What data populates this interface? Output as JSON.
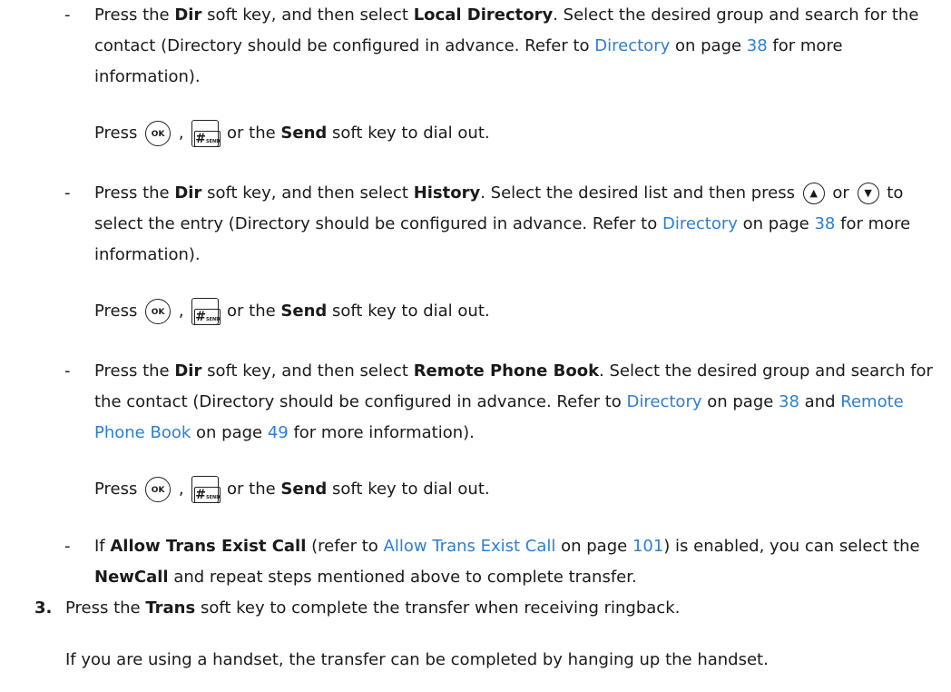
{
  "colors": {
    "link": "#2d7fd0",
    "text": "#1a1a1a"
  },
  "keys": {
    "ok": "OK",
    "send_hash": "#",
    "send_sub": "SEND",
    "up": "▲",
    "down": "▼"
  },
  "bullet_dash": "-",
  "item1": {
    "t1": "Press the ",
    "b1": "Dir",
    "t2": " soft key, and then select ",
    "b2": "Local Directory",
    "t3": ". Select the desired group and search for the contact (Directory should be configured in advance. Refer to ",
    "l1": "Directory",
    "t4": " on page ",
    "l2": "38",
    "t5": " for more information).",
    "press": "Press ",
    "comma": " , ",
    "or_the": " or the ",
    "send": "Send",
    "dial": " soft key to dial out."
  },
  "item2": {
    "t1": "Press the ",
    "b1": "Dir",
    "t2": " soft key, and then select ",
    "b2": "History",
    "t3": ". Select the desired list and then press ",
    "or": " or ",
    "t4": " to select the entry (Directory should be configured in advance. Refer to ",
    "l1": "Directory",
    "t5": " on page ",
    "l2": "38",
    "t6": " for more information).",
    "press": "Press ",
    "comma": " , ",
    "or_the": " or the ",
    "send": "Send",
    "dial": " soft key to dial out."
  },
  "item3": {
    "t1": "Press the ",
    "b1": "Dir",
    "t2": " soft key, and then select ",
    "b2": "Remote Phone Book",
    "t3": ". Select the desired group and search for the contact (Directory should be configured in advance. Refer to ",
    "l1": "Directory",
    "t4": " on page ",
    "l2": "38",
    "t5": " and ",
    "l3": "Remote Phone Book",
    "t6": " on page ",
    "l4": "49",
    "t7": " for more information).",
    "press": "Press ",
    "comma": " , ",
    "or_the": " or the ",
    "send": "Send",
    "dial": " soft key to dial out."
  },
  "item4": {
    "t1": "If ",
    "b1": "Allow Trans Exist Call",
    "t2": " (refer to ",
    "l1": "Allow Trans Exist Call",
    "t3": " on page ",
    "l2": "101",
    "t4": ") is enabled, you can select the ",
    "b2": "NewCall",
    "t5": " and repeat steps mentioned above to complete transfer."
  },
  "step3": {
    "number": "3.",
    "t1": "Press the ",
    "b1": "Trans",
    "t2": " soft key to complete the transfer when receiving ringback.",
    "note": "If you are using a handset, the transfer can be completed by hanging up the handset."
  }
}
